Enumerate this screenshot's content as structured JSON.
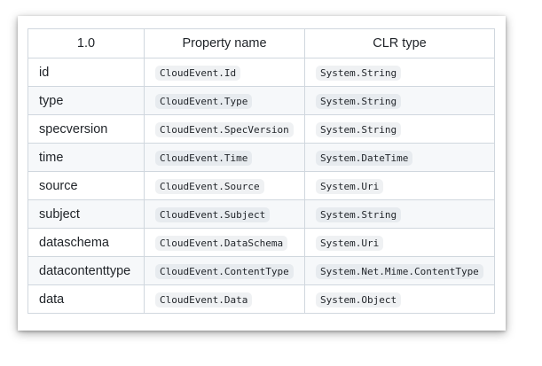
{
  "table": {
    "headers": [
      "1.0",
      "Property name",
      "CLR type"
    ],
    "rows": [
      {
        "attribute": "id",
        "property": "CloudEvent.Id",
        "clr_type": "System.String"
      },
      {
        "attribute": "type",
        "property": "CloudEvent.Type",
        "clr_type": "System.String"
      },
      {
        "attribute": "specversion",
        "property": "CloudEvent.SpecVersion",
        "clr_type": "System.String"
      },
      {
        "attribute": "time",
        "property": "CloudEvent.Time",
        "clr_type": "System.DateTime"
      },
      {
        "attribute": "source",
        "property": "CloudEvent.Source",
        "clr_type": "System.Uri"
      },
      {
        "attribute": "subject",
        "property": "CloudEvent.Subject",
        "clr_type": "System.String"
      },
      {
        "attribute": "dataschema",
        "property": "CloudEvent.DataSchema",
        "clr_type": "System.Uri"
      },
      {
        "attribute": "datacontenttype",
        "property": "CloudEvent.ContentType",
        "clr_type": "System.Net.Mime.ContentType"
      },
      {
        "attribute": "data",
        "property": "CloudEvent.Data",
        "clr_type": "System.Object"
      }
    ]
  }
}
